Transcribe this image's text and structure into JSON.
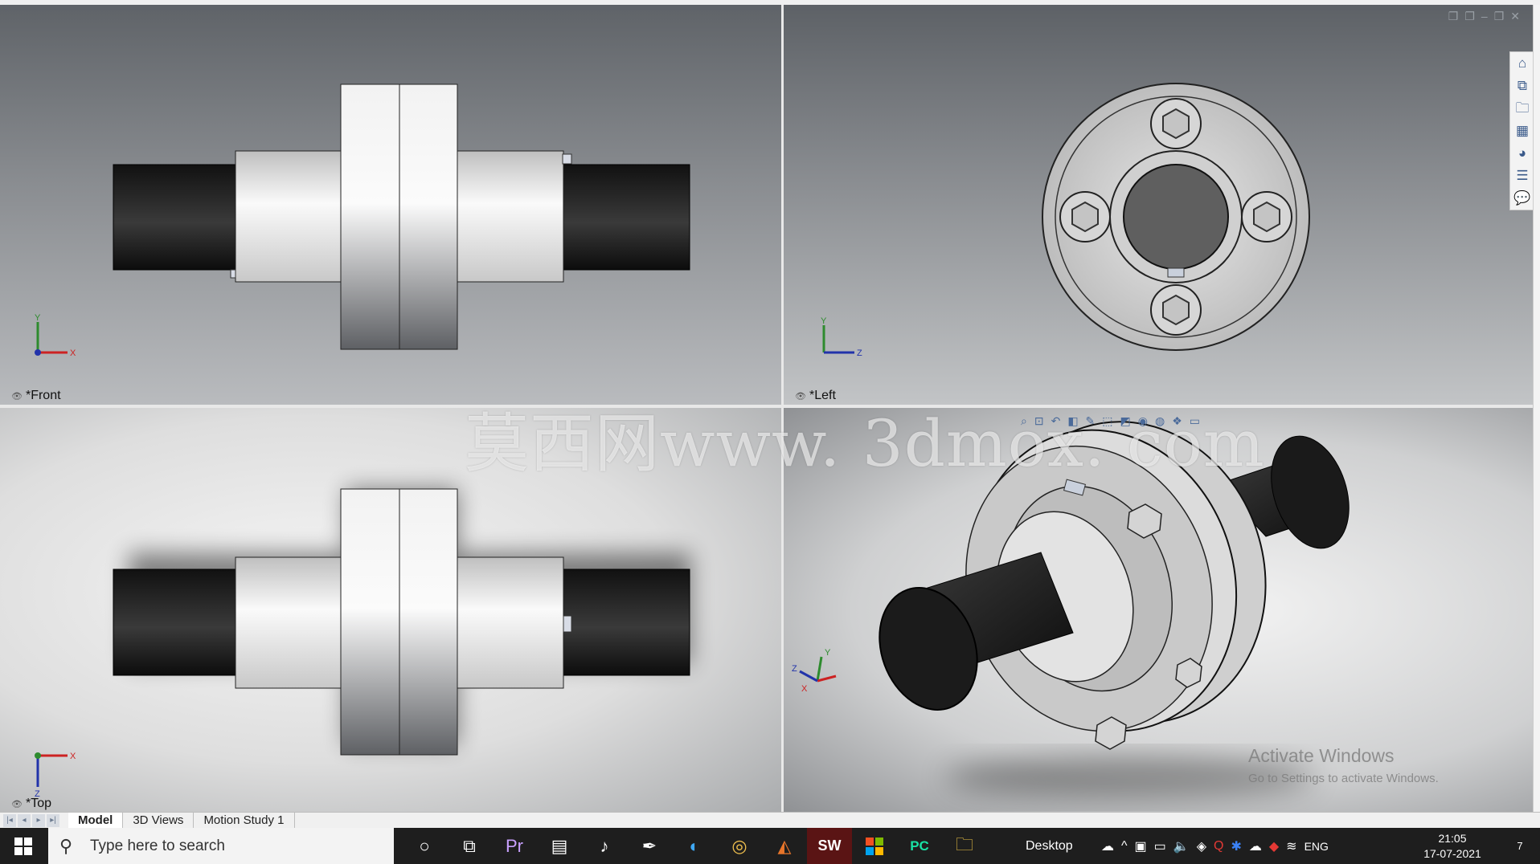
{
  "viewports": {
    "front": {
      "label": "*Front"
    },
    "left": {
      "label": "*Left"
    },
    "top": {
      "label": "*Top"
    }
  },
  "triad": {
    "x": "X",
    "y": "Y",
    "z": "Z"
  },
  "watermark": {
    "text": "莫西网www. 3dmox. com"
  },
  "activation": {
    "title": "Activate Windows",
    "subtitle": "Go to Settings to activate Windows."
  },
  "tabs": [
    "Model",
    "3D Views",
    "Motion Study 1"
  ],
  "taskbar": {
    "search_placeholder": "Type here to search",
    "desktop_label": "Desktop",
    "language": "ENG",
    "time": "21:05",
    "date": "17-07-2021",
    "app_icons": [
      "cortana-icon",
      "task-view-icon",
      "premiere-pro-icon",
      "file-manager-icon",
      "itunes-icon",
      "inkscape-icon",
      "edge-icon",
      "chrome-icon",
      "matlab-icon",
      "solidworks-icon",
      "microsoft-store-icon",
      "pycharm-icon",
      "file-explorer-icon"
    ],
    "solidworks_label": "SW",
    "pycharm_label": "PC",
    "premiere_label": "Pr",
    "notification_count": "7"
  },
  "colors": {
    "taskbar": "#1e1e1e",
    "shaft_dark": "#1a1a1a",
    "part_light": "#f4f4f4"
  }
}
